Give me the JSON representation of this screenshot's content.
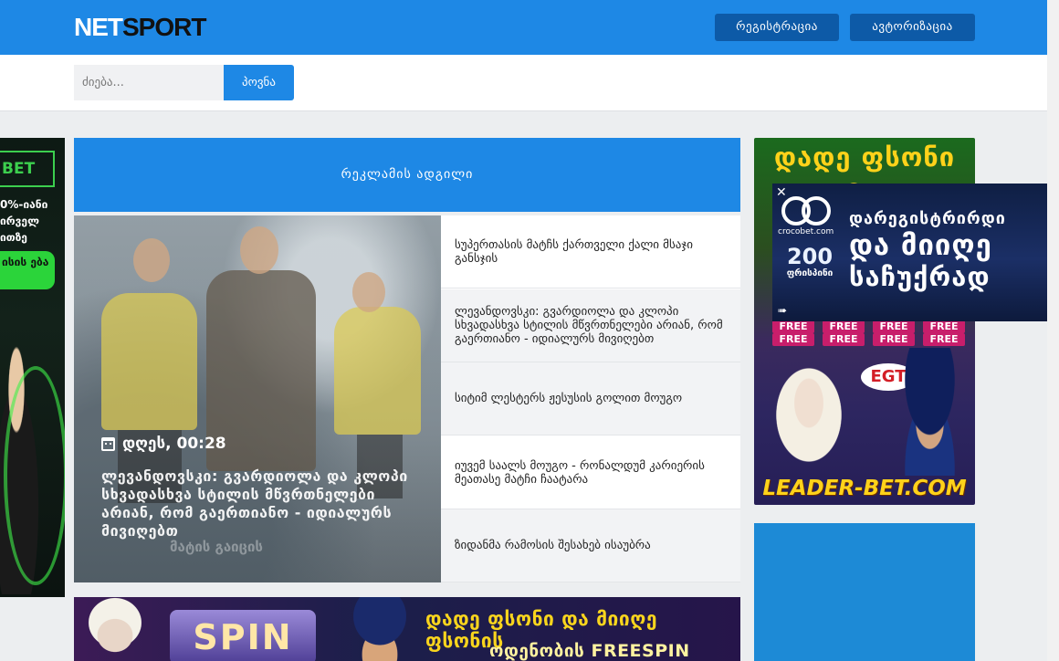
{
  "header": {
    "logo_part1": "NET",
    "logo_part2": "SPORT",
    "register_label": "რეგისტრაცია",
    "auth_label": "ავტორიზაცია"
  },
  "search": {
    "placeholder": "ძიება...",
    "button_label": "პოვნა"
  },
  "ad_space": {
    "label": "რეკლამის ადგილი"
  },
  "left_ad": {
    "brand": "BET",
    "line1": "0%-იანი",
    "line2": "ირველ",
    "line3": "ითზე",
    "pill": "ისის ება"
  },
  "featured": {
    "date": "დღეს, 00:28",
    "title": "ლევანდოვსკი: გვარდიოლა და კლოპი სხვადასხვა სტილის მწვრთნელები არიან, რომ გაერთიანო - იდიალურს მივიღებთ",
    "ghost_text": "მატის გაიცის"
  },
  "news": [
    {
      "title": "სუპერთასის მატჩს ქართველი ქალი მსაჯი განსჯის"
    },
    {
      "title": "ლევანდოვსკი: გვარდიოლა და კლოპი სხვადასხვა სტილის მწვრთნელები არიან, რომ გაერთიანო - იდიალურს მივიღებთ"
    },
    {
      "title": "სიტიმ ლესტერს ჟესუსის გოლით მოუგო"
    },
    {
      "title": "იუვემ საალს მოუგო - რონალდუმ კარიერის მეათასე მატჩი ჩაატარა"
    },
    {
      "title": "ზიდანმა რამოსის შესახებ ისაუბრა"
    }
  ],
  "bottom_banner": {
    "spin": "SPIN",
    "line1": "დადე ფსონი და მიიღე ფსონის",
    "line2": "ოდენობის FREESPIN"
  },
  "right_ad": {
    "top_text": "დადე ფსონი და მიიღე",
    "free_label": "FREE",
    "egt": "EGT",
    "site": "LEADER-BET.COM"
  },
  "popup_ad": {
    "close": "✕",
    "logo_text": "crocobet.com",
    "bonus_number": "200",
    "bonus_label": "ფრისპინი",
    "line1": "დარეგისტრირდი",
    "line2": "და მიიღე",
    "line3": "საჩუქრად"
  },
  "colors": {
    "brand_blue": "#1e88e5",
    "dark_button": "#0d5aa7",
    "page_bg": "#eceef0"
  }
}
